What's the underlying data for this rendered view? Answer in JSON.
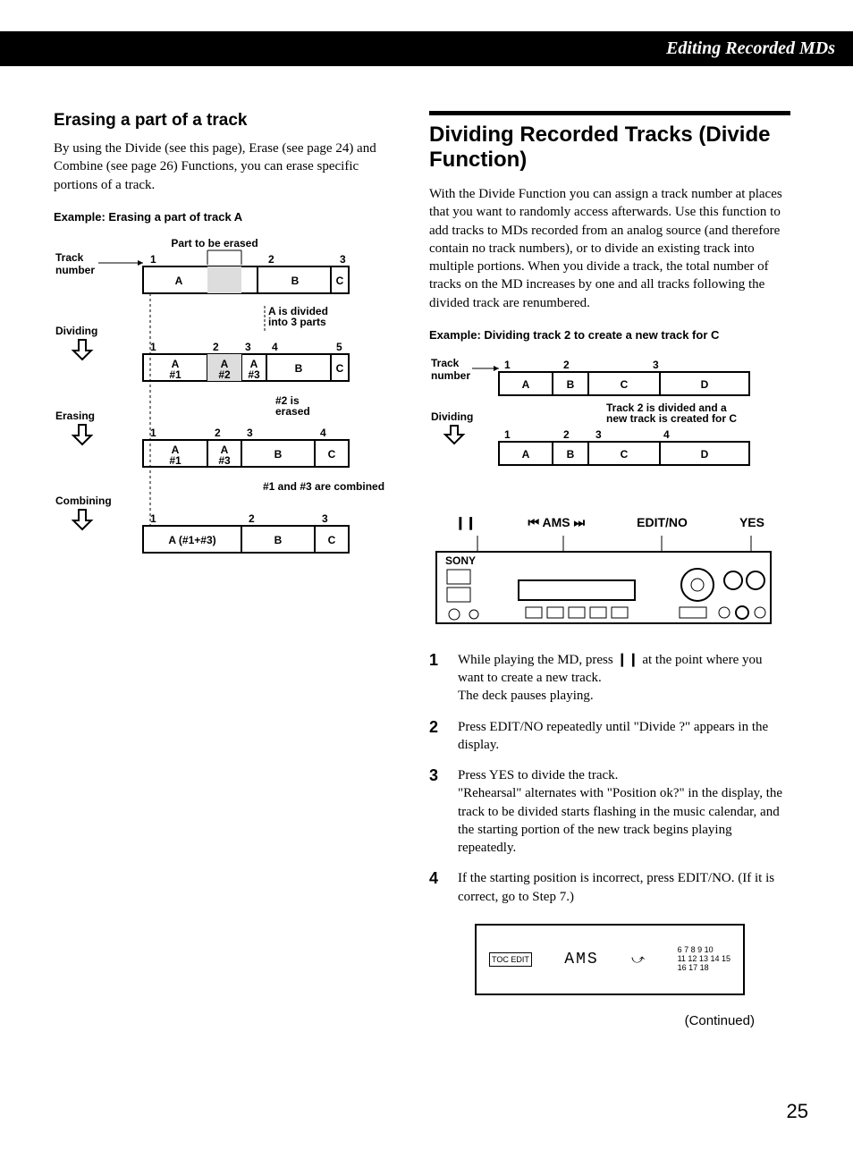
{
  "header": {
    "section": "Editing Recorded MDs"
  },
  "left": {
    "title": "Erasing a part of a track",
    "intro": "By using the Divide (see this page), Erase (see page 24) and Combine (see page 26) Functions, you can erase specific portions of a track.",
    "example": "Example: Erasing a part of track A",
    "diag": {
      "part_label": "Part to be erased",
      "track_label": "Track number",
      "stages": [
        "Dividing",
        "Erasing",
        "Combining"
      ],
      "row1_nums": [
        "1",
        "2",
        "3"
      ],
      "row1_cells": [
        "A",
        "B",
        "C"
      ],
      "note1": "A is divided into 3 parts",
      "row2_nums": [
        "1",
        "2",
        "3",
        "4",
        "5"
      ],
      "row2_cells": [
        "A #1",
        "A #2",
        "A #3",
        "B",
        "C"
      ],
      "note2": "#2 is erased",
      "row3_nums": [
        "1",
        "2",
        "3",
        "4"
      ],
      "row3_cells": [
        "A #1",
        "A #3",
        "B",
        "C"
      ],
      "note3": "#1 and #3 are combined",
      "row4_nums": [
        "1",
        "2",
        "3"
      ],
      "row4_cells": [
        "A (#1+#3)",
        "B",
        "C"
      ]
    }
  },
  "right": {
    "title": "Dividing Recorded Tracks (Divide Function)",
    "intro": "With the Divide Function you can assign a track number at places that you want to randomly access afterwards. Use this function to add tracks to MDs recorded from an analog source (and therefore contain no track numbers), or to divide an existing track into multiple portions. When you divide a track, the total number of tracks on the MD increases by one and all tracks following the divided track are renumbered.",
    "example": "Example: Dividing track 2 to create a new track for C",
    "diag": {
      "track_label": "Track number",
      "stage": "Dividing",
      "row1_nums": [
        "1",
        "2",
        "3"
      ],
      "row1_cells": [
        "A",
        "B",
        "C",
        "D"
      ],
      "note": "Track 2 is divided and a new track is created for C",
      "row2_nums": [
        "1",
        "2",
        "3",
        "4"
      ],
      "row2_cells": [
        "A",
        "B",
        "C",
        "D"
      ]
    },
    "controls": {
      "pause": "❙❙",
      "ams": "⏮ AMS ⏭",
      "edit": "EDIT/NO",
      "yes": "YES"
    },
    "steps": [
      {
        "n": "1",
        "t": "While playing the MD, press ❙❙ at the point where you want to create a new track.\nThe deck pauses playing."
      },
      {
        "n": "2",
        "t": "Press EDIT/NO repeatedly until \"Divide ?\" appears in the display."
      },
      {
        "n": "3",
        "t": "Press YES to divide the track.\n\"Rehearsal\" alternates with \"Position ok?\" in the display, the track to be divided starts flashing in the music calendar, and the starting portion of the new track begins playing repeatedly."
      },
      {
        "n": "4",
        "t": "If the starting position is incorrect, press EDIT/NO. (If it is correct, go to Step 7.)"
      }
    ],
    "display": {
      "ams": "AMS",
      "cal": "6 7 8 9 10\n11 12 13 14 15\n16 17 18",
      "toc": "TOC EDIT"
    },
    "continued": "(Continued)"
  },
  "page": "25"
}
